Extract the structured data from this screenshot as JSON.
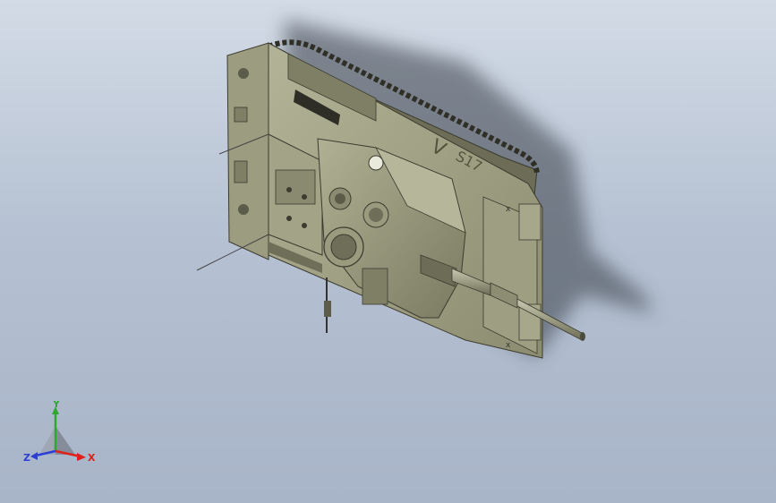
{
  "viewport": {
    "background_top": "#d3dbe6",
    "background_bottom": "#a8b4c7"
  },
  "model": {
    "hull_color": "#8f8f74",
    "hull_light": "#a9a98c",
    "hull_dark": "#5b5b48",
    "turret_color": "#9d9d82",
    "hull_marking_chevron": "V",
    "hull_marking_number": "S17"
  },
  "triad": {
    "x_label": "X",
    "y_label": "Y",
    "z_label": "Z",
    "x_color": "#e0201a",
    "y_color": "#2ea82e",
    "z_color": "#2b3fd6"
  }
}
